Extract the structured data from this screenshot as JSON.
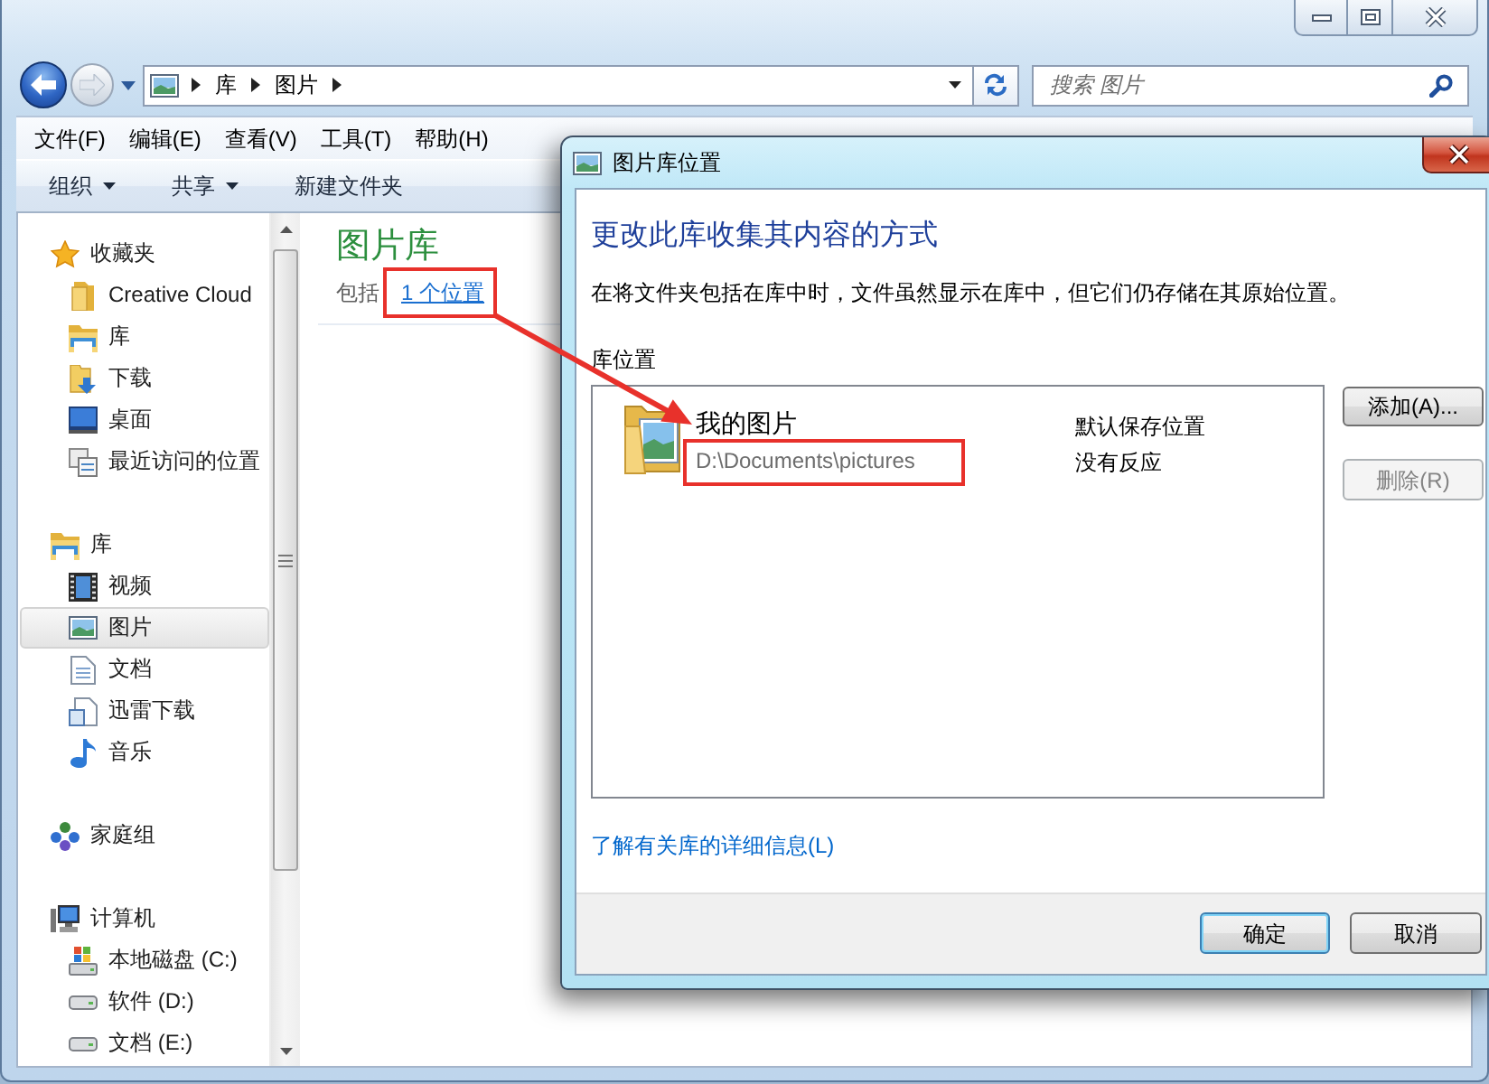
{
  "explorer": {
    "address_path": [
      "库",
      "图片"
    ],
    "search": {
      "placeholder": "搜索 图片"
    },
    "menu_bar": [
      "文件(F)",
      "编辑(E)",
      "查看(V)",
      "工具(T)",
      "帮助(H)"
    ],
    "toolbar": [
      {
        "label": "组织",
        "dropdown": true
      },
      {
        "label": "共享",
        "dropdown": true
      },
      {
        "label": "新建文件夹",
        "dropdown": false
      }
    ],
    "sidebar": [
      {
        "label": "收藏夹",
        "kind": "star",
        "selected": false,
        "children": [
          {
            "label": "Creative Cloud",
            "kind": "folder",
            "selected": false
          },
          {
            "label": "库",
            "kind": "library",
            "selected": false
          },
          {
            "label": "下载",
            "kind": "download",
            "selected": false
          },
          {
            "label": "桌面",
            "kind": "desktop",
            "selected": false
          },
          {
            "label": "最近访问的位置",
            "kind": "recent",
            "selected": false
          }
        ]
      },
      {
        "label": "库",
        "kind": "library",
        "selected": false,
        "children": [
          {
            "label": "视频",
            "kind": "video",
            "selected": false
          },
          {
            "label": "图片",
            "kind": "picture",
            "selected": true
          },
          {
            "label": "文档",
            "kind": "document",
            "selected": false
          },
          {
            "label": "迅雷下载",
            "kind": "thunder",
            "selected": false
          },
          {
            "label": "音乐",
            "kind": "music",
            "selected": false
          }
        ]
      },
      {
        "label": "家庭组",
        "kind": "homegroup",
        "selected": false
      },
      {
        "label": "计算机",
        "kind": "computer",
        "selected": false,
        "children": [
          {
            "label": "本地磁盘 (C:)",
            "kind": "systemdrive",
            "selected": false
          },
          {
            "label": "软件 (D:)",
            "kind": "drive",
            "selected": false
          },
          {
            "label": "文档 (E:)",
            "kind": "drive",
            "selected": false
          }
        ]
      }
    ],
    "library": {
      "title": "图片库",
      "includes_label": "包括",
      "locations_link": {
        "text": "1 个位置",
        "highlighted": true
      }
    }
  },
  "dialog": {
    "title": "图片库位置",
    "heading": "更改此库收集其内容的方式",
    "description": "在将文件夹包括在库中时，文件虽然显示在库中，但它们仍存储在其原始位置。",
    "list_label": "库位置",
    "locations": [
      {
        "name": "我的图片",
        "path": "D:\\Documents\\pictures",
        "path_highlighted": true,
        "status": "默认保存位置",
        "note": "没有反应"
      }
    ],
    "side_buttons": [
      {
        "label": "添加(A)...",
        "disabled": false
      },
      {
        "label": "删除(R)",
        "disabled": true
      }
    ],
    "help_link": "了解有关库的详细信息(L)",
    "buttons": [
      {
        "label": "确定",
        "default": true
      },
      {
        "label": "取消",
        "default": false
      }
    ]
  }
}
